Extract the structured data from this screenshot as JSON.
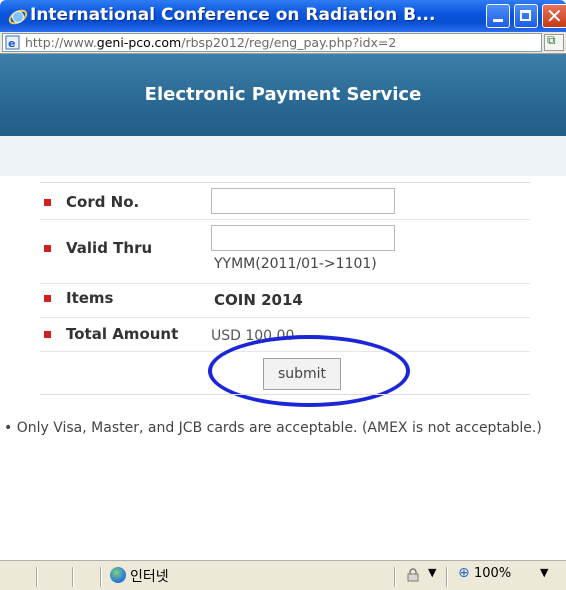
{
  "window": {
    "title": "International Conference on Radiation B...",
    "url_prefix": "http://www.",
    "url_domain": "geni-pco.com",
    "url_path": "/rbsp2012/reg/eng_pay.php?idx=2"
  },
  "header": {
    "title": "Electronic Payment Service"
  },
  "form": {
    "card_label": "Cord No.",
    "card_value": "",
    "valid_label": "Valid Thru",
    "valid_value": "",
    "valid_hint": "YYMM(2011/01->1101)",
    "items_label": "Items",
    "items_value": "COIN 2014",
    "amount_label": "Total Amount",
    "amount_value": "USD 100.00",
    "submit_label": "submit"
  },
  "note": "• Only Visa, Master, and JCB cards are acceptable. (AMEX is not acceptable.)",
  "statusbar": {
    "zone": "인터넷",
    "zoom": "100%"
  },
  "colors": {
    "header_bg": "#2a6a94",
    "bullet": "#d02020",
    "annotation_ellipse": "#1a26d8"
  },
  "icons": [
    "ie-logo-icon",
    "minimize-icon",
    "maximize-icon",
    "close-icon",
    "page-icon",
    "globe-icon",
    "lock-icon",
    "zoom-icon",
    "chevron-down-icon"
  ]
}
